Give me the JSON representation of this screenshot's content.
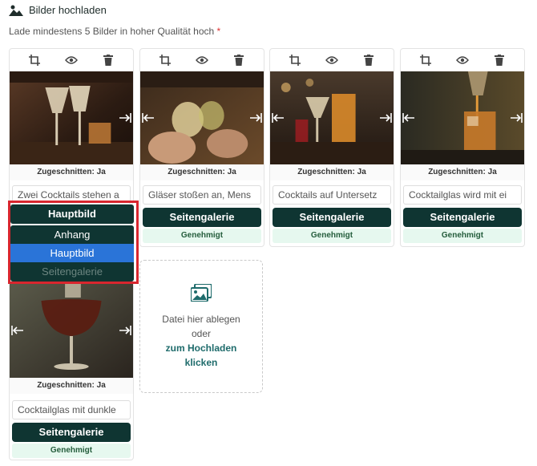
{
  "header": {
    "title": "Bilder hochladen",
    "icon": "image-upload-icon"
  },
  "subtitle": {
    "text": "Lade mindestens 5 Bilder in hoher Qualität hoch",
    "required_mark": "*"
  },
  "cards": [
    {
      "cropped": "Zugeschnitten: Ja",
      "caption": "Zwei Cocktails stehen a",
      "badge": ""
    },
    {
      "cropped": "Zugeschnitten: Ja",
      "caption": "Gläser stoßen an, Mens",
      "button": "Seitengalerie",
      "badge": "Genehmigt"
    },
    {
      "cropped": "Zugeschnitten: Ja",
      "caption": "Cocktails auf Untersetz",
      "button": "Seitengalerie",
      "badge": "Genehmigt"
    },
    {
      "cropped": "Zugeschnitten: Ja",
      "caption": "Cocktailglas wird mit ei",
      "button": "Seitengalerie",
      "badge": "Genehmigt"
    },
    {
      "cropped": "Zugeschnitten: Ja",
      "caption": "Cocktailglas mit dunkle",
      "button": "Seitengalerie",
      "badge": "Genehmigt"
    }
  ],
  "dropdown": {
    "selected": "Hauptbild",
    "options": [
      "Anhang",
      "Hauptbild",
      "Seitengalerie"
    ]
  },
  "dropzone": {
    "line1": "Datei hier ablegen",
    "line2": "oder",
    "link1": "zum Hochladen",
    "link2": "klicken"
  },
  "colors": {
    "primary": "#0f3532",
    "accent": "#2a74d8",
    "highlight": "#d8262e",
    "approved_bg": "#e6f8ef"
  }
}
